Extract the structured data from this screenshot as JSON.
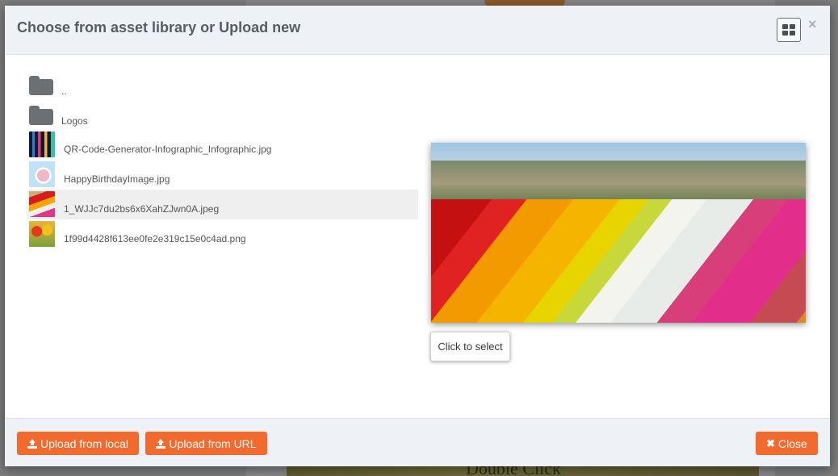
{
  "backdrop": {
    "text": "Double Click"
  },
  "modal": {
    "title": "Choose from asset library or Upload new",
    "close_glyph": "×",
    "grid_icon": "grid-view-icon"
  },
  "files": [
    {
      "type": "folder",
      "name": "..",
      "icon": "folder-icon"
    },
    {
      "type": "folder",
      "name": "Logos",
      "icon": "folder-icon"
    },
    {
      "type": "image",
      "name": "QR-Code-Generator-Infographic_Infographic.jpg"
    },
    {
      "type": "image",
      "name": "HappyBirthdayImage.jpg"
    },
    {
      "type": "image",
      "name": "1_WJJc7du2bs6x6XahZJwn0A.jpeg",
      "selected": true
    },
    {
      "type": "image",
      "name": "1f99d4428f613ee0fe2e319c15e0c4ad.png"
    }
  ],
  "preview": {
    "select_label": "Click to select"
  },
  "footer": {
    "upload_local_label": "Upload from local",
    "upload_url_label": "Upload from URL",
    "close_label": "Close",
    "close_glyph": "✖"
  },
  "colors": {
    "accent": "#f26a2e",
    "header_bg": "#eef2f6",
    "selected_row": "#efefef"
  }
}
